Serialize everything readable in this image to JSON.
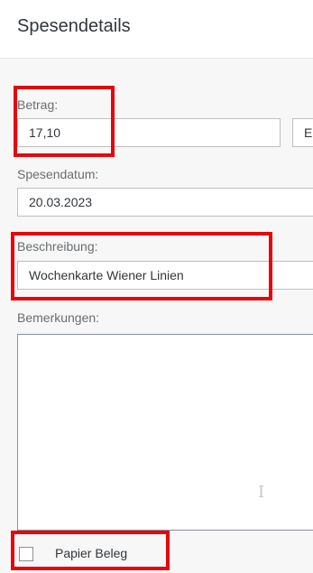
{
  "header": {
    "title": "Spesendetails"
  },
  "form": {
    "betrag": {
      "label": "Betrag:",
      "value": "17,10",
      "currency": "EUR"
    },
    "spesendatum": {
      "label": "Spesendatum:",
      "value": "20.03.2023"
    },
    "beschreibung": {
      "label": "Beschreibung:",
      "value": "Wochenkarte Wiener Linien"
    },
    "bemerkungen": {
      "label": "Bemerkungen:",
      "value": ""
    },
    "papier_beleg": {
      "label": "Papier Beleg",
      "checked": false
    }
  },
  "colors": {
    "highlight": "#e5060d",
    "label_text": "#6a6d70",
    "value_text": "#32363a",
    "field_border": "#bfbfbf",
    "background": "#f7f7f7"
  }
}
